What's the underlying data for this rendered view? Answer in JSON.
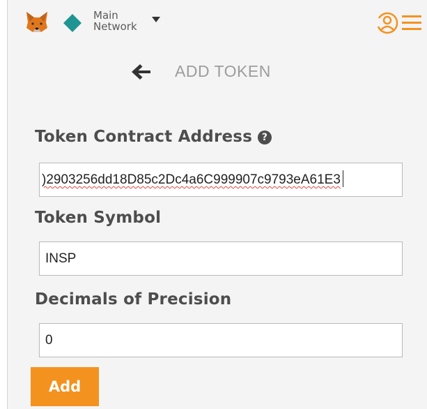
{
  "network": {
    "line1": "Main",
    "line2": "Network",
    "color": "#1e9593"
  },
  "header": {
    "back_icon": "left-arrow-icon",
    "title": "ADD TOKEN"
  },
  "form": {
    "address_label": "Token Contract Address",
    "address_help_icon": "question-circle-icon",
    "address_value": ")2903256dd18D85c2Dc4a6C999907c9793eA61E3",
    "symbol_label": "Token Symbol",
    "symbol_value": "INSP",
    "decimals_label": "Decimals of Precision",
    "decimals_value": "0"
  },
  "actions": {
    "add_label": "Add",
    "accent_color": "#f4921f"
  },
  "icons": {
    "logo": "metamask-fox-icon",
    "network": "diamond-icon",
    "dropdown": "caret-down-icon",
    "account": "account-icon",
    "menu": "hamburger-menu-icon"
  }
}
